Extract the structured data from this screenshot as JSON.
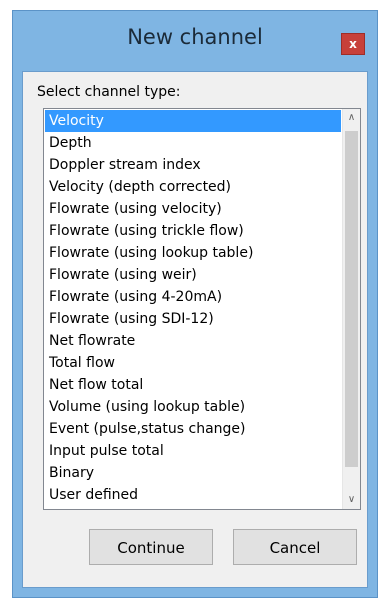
{
  "window": {
    "title": "New channel",
    "close_glyph": "x"
  },
  "dialog": {
    "prompt": "Select channel type:",
    "items": [
      "Velocity",
      "Depth",
      "Doppler stream index",
      "Velocity (depth corrected)",
      "Flowrate (using velocity)",
      "Flowrate (using trickle flow)",
      "Flowrate (using lookup table)",
      "Flowrate (using weir)",
      "Flowrate (using 4-20mA)",
      "Flowrate (using SDI-12)",
      "Net flowrate",
      "Total flow",
      "Net flow total",
      "Volume (using lookup table)",
      "Event (pulse,status change)",
      "Input pulse total",
      "Binary",
      "User defined"
    ],
    "selected_item": "Velocity",
    "scroll_up_glyph": "∧",
    "scroll_down_glyph": "∨"
  },
  "buttons": {
    "continue_label": "Continue",
    "cancel_label": "Cancel"
  },
  "colors": {
    "title_bar": "#7fb5e3",
    "close_button": "#c7403a",
    "selection": "#3399ff"
  }
}
